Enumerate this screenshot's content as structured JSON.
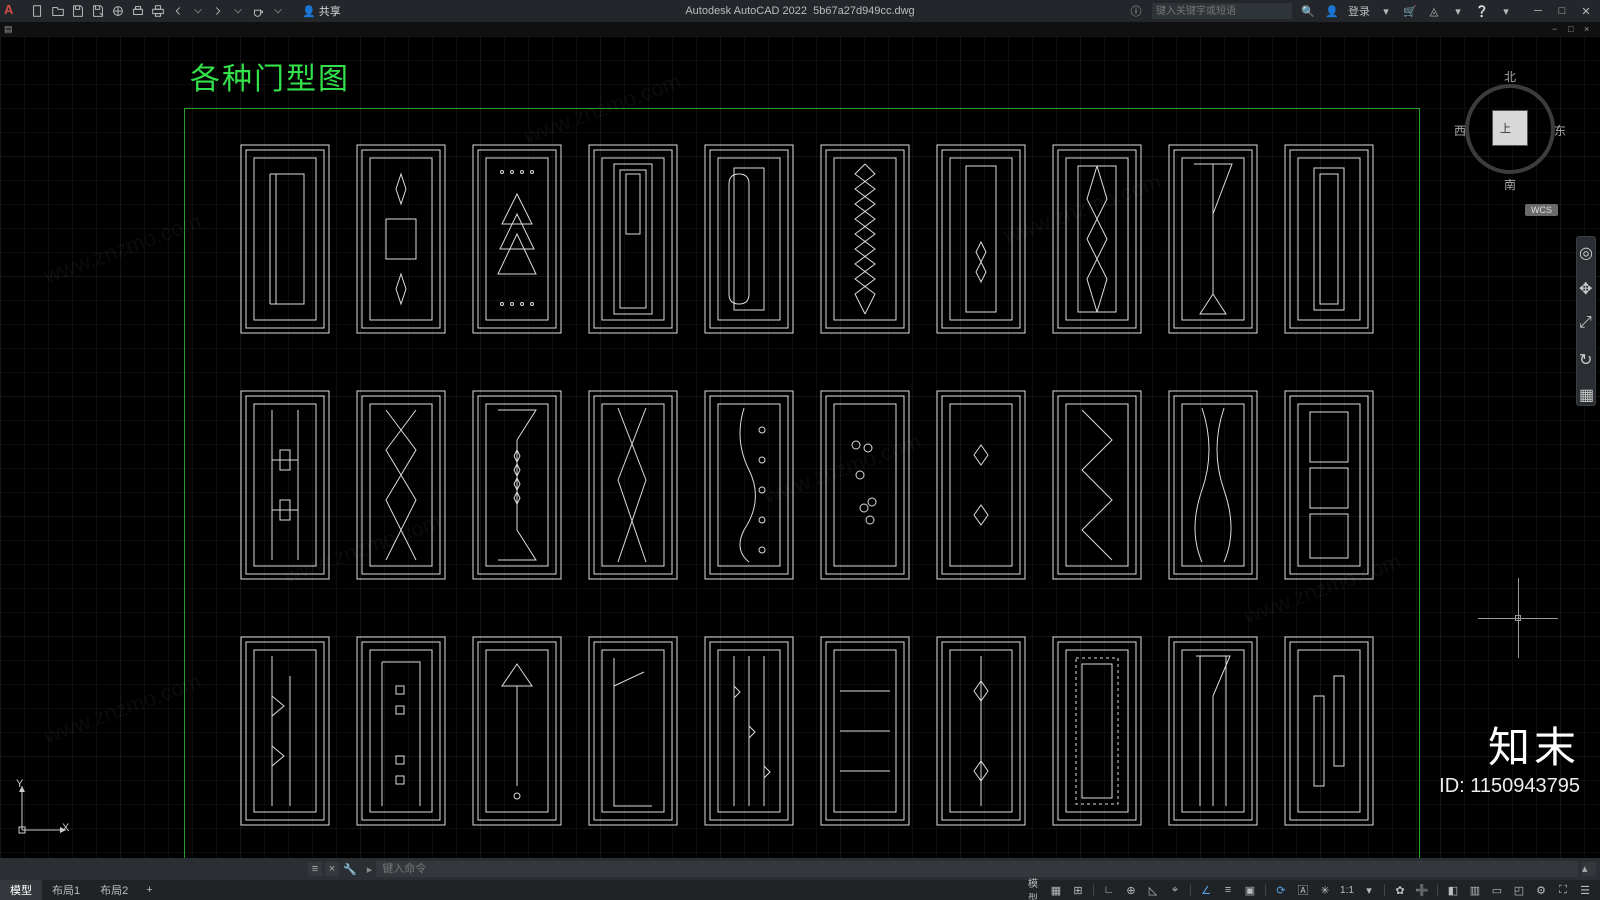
{
  "app": {
    "logo": "A",
    "title_app": "Autodesk AutoCAD 2022",
    "title_file": "5b67a27d949cc.dwg",
    "share_label": "共享",
    "search_placeholder": "键入关键字或短语",
    "login_label": "登录"
  },
  "viewtabs": {
    "minus": "−",
    "restore": "□",
    "close": "×"
  },
  "drawing": {
    "title": "各种门型图"
  },
  "viewcube": {
    "north": "北",
    "south": "南",
    "east": "东",
    "west": "西",
    "top": "上",
    "wcs": "WCS"
  },
  "ucs": {
    "x": "X",
    "y": "Y"
  },
  "cmdline": {
    "close": "×",
    "handle": "≡",
    "chevron": "›",
    "prompt": "▸",
    "placeholder": "键入命令"
  },
  "layout_tabs": {
    "model": "模型",
    "layout1": "布局1",
    "layout2": "布局2",
    "plus": "+"
  },
  "status": {
    "model": "模型",
    "scale": "1:1"
  },
  "watermark": {
    "brand": "知末",
    "url": "www.znzmo.com",
    "id_label": "ID: 1150943795"
  }
}
